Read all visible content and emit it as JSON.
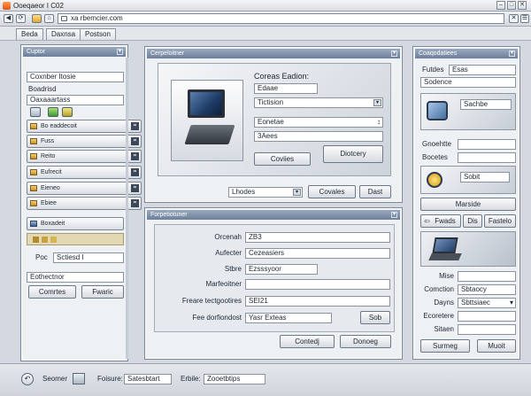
{
  "window": {
    "title": "Ooeqaeor I C02",
    "url": "xa rbemcier.com"
  },
  "tabs": [
    "Beda",
    "Daxnsa",
    "Postson"
  ],
  "left_panel": {
    "title": "Cuptor",
    "fields": [
      "Coxnber Itosie",
      "Boadrisd",
      "Oaxaaartass"
    ],
    "rows": [
      "Bo eaddecoit",
      "Fuss",
      "Reito",
      "Eufrecit",
      "Eieneo",
      "Ebiee"
    ],
    "row_bottom": "Boxadeit",
    "pec_label": "Poc",
    "pec_value": "Sctiesd I",
    "search_value": "Eothectnor",
    "buttons": [
      "Comrtes",
      "Fwaric"
    ]
  },
  "center_top": {
    "title": "Cerpeloitner",
    "heading": "Coreas Eadion:",
    "field1": "Edaae",
    "dropdown1": "Tictision",
    "field3": "Eonetae",
    "field4": "3Aees",
    "buttons": [
      "Coviies",
      "Diotcery"
    ],
    "dropdown2": "Lhodes",
    "bottom_buttons": [
      "Covales",
      "Dast"
    ]
  },
  "center_bottom": {
    "title": "Forpetiotuner",
    "rows": [
      {
        "label": "Orcenah",
        "value": "ZB3"
      },
      {
        "label": "Aufecter",
        "value": "Cezeasiers"
      },
      {
        "label": "Stbre",
        "value": "Ezsssyoor"
      },
      {
        "label": "Marfeoitner",
        "value": ""
      },
      {
        "label": "Freare tectgootires",
        "value": "SEI21"
      },
      {
        "label": "Fee dorfiondost",
        "value": "Yasr Exteas"
      }
    ],
    "side_button": "Sob",
    "buttons": [
      "Contedj",
      "Donoeg"
    ]
  },
  "right_panel": {
    "title": "Coaqodatiees",
    "row1_label": "Futdes",
    "row1_value": "Esas",
    "row2_value": "Sodence",
    "card1_text": "Sachbe",
    "label_a": "Gnoehtte",
    "label_b": "Bocetes",
    "card2_text": "Sobit",
    "button_wide": "Marside",
    "small_buttons": [
      "Fwads",
      "Dis",
      "Fastelo"
    ],
    "form": [
      {
        "label": "Mise",
        "value": ""
      },
      {
        "label": "Comction",
        "value": "Sbtaocy"
      },
      {
        "label": "Dayns",
        "value": "Sbttsiaec"
      },
      {
        "label": "Ecoretere",
        "value": ""
      },
      {
        "label": "Sitaen",
        "value": ""
      }
    ],
    "buttons": [
      "Surmeg",
      "Muoit"
    ]
  },
  "statusbar": {
    "label1": "Seomer",
    "label2": "Foisure:",
    "value2": "Satesbtart",
    "label3": "Erbile:",
    "value3": "Zooetbtips"
  }
}
